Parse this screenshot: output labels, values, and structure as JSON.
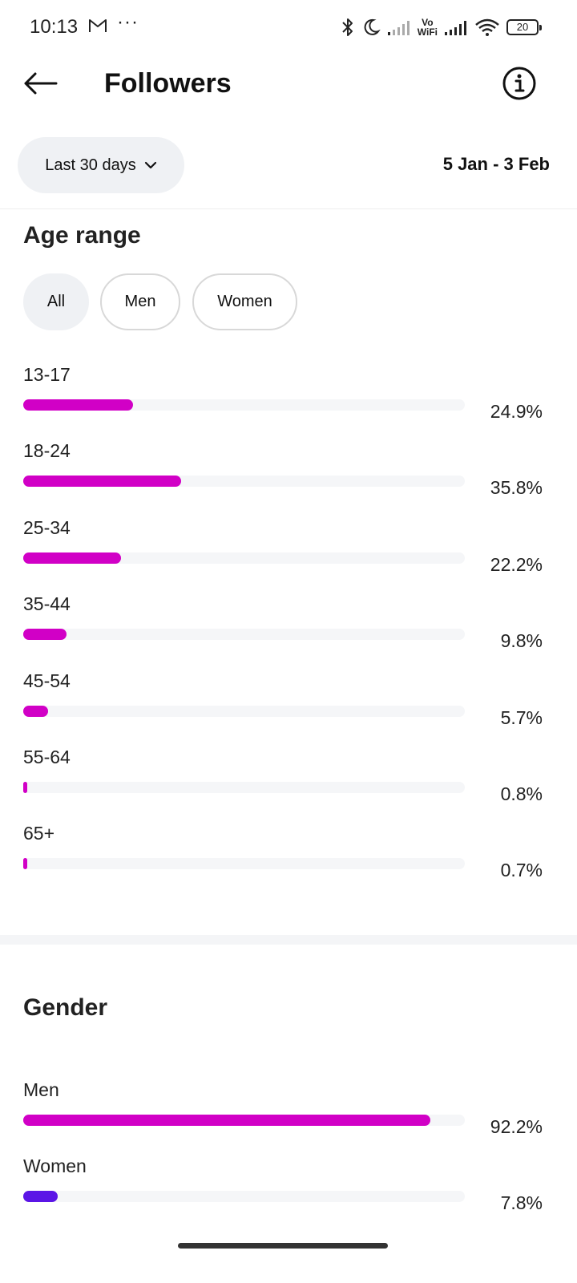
{
  "status_bar": {
    "time": "10:13",
    "dots": "···",
    "vo_label": "Vo",
    "wifi_label": "WiFi",
    "battery": "20"
  },
  "header": {
    "title": "Followers"
  },
  "filters": {
    "range_label": "Last 30 days",
    "date_range": "5 Jan - 3 Feb"
  },
  "age_section": {
    "title": "Age range",
    "tabs": [
      "All",
      "Men",
      "Women"
    ],
    "active_tab": "All",
    "bars": [
      {
        "label": "13-17",
        "value": 24.9,
        "pct": "24.9%"
      },
      {
        "label": "18-24",
        "value": 35.8,
        "pct": "35.8%"
      },
      {
        "label": "25-34",
        "value": 22.2,
        "pct": "22.2%"
      },
      {
        "label": "35-44",
        "value": 9.8,
        "pct": "9.8%"
      },
      {
        "label": "45-54",
        "value": 5.7,
        "pct": "5.7%"
      },
      {
        "label": "55-64",
        "value": 0.8,
        "pct": "0.8%"
      },
      {
        "label": "65+",
        "value": 0.7,
        "pct": "0.7%"
      }
    ]
  },
  "gender_section": {
    "title": "Gender",
    "bars": [
      {
        "label": "Men",
        "value": 92.2,
        "pct": "92.2%"
      },
      {
        "label": "Women",
        "value": 7.8,
        "pct": "7.8%"
      }
    ]
  },
  "colors": {
    "accent_magenta": "#d100c6",
    "accent_purple": "#5b15e6",
    "track": "#f5f6f8"
  }
}
